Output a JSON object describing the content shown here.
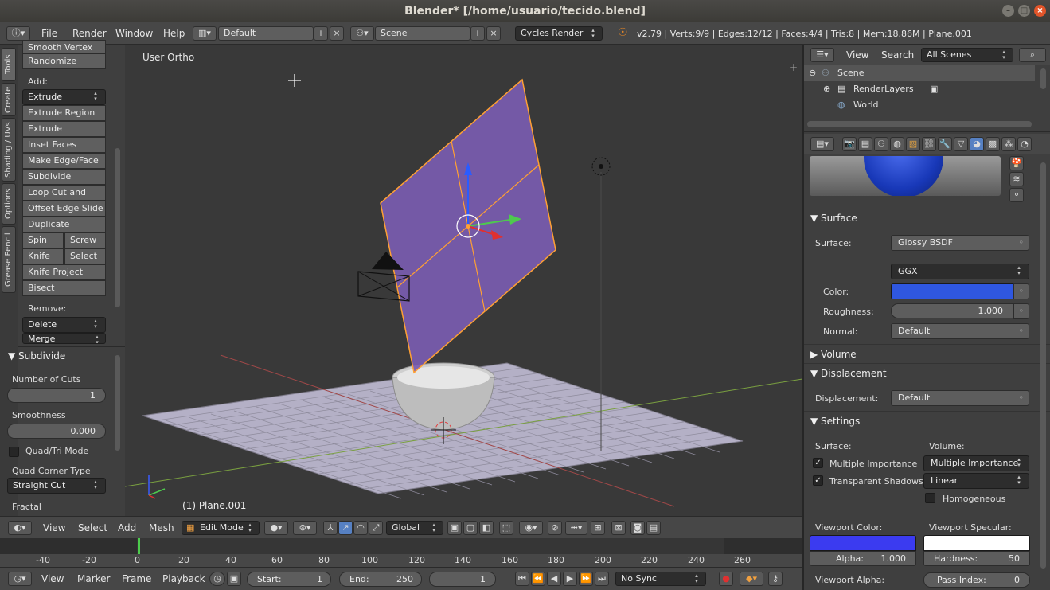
{
  "window": {
    "title": "Blender* [/home/usuario/tecido.blend]"
  },
  "infobar": {
    "menus": [
      "File",
      "Render",
      "Window",
      "Help"
    ],
    "layout": "Default",
    "scene": "Scene",
    "engine": "Cycles Render",
    "stats": "v2.79 | Verts:9/9 | Edges:12/12 | Faces:4/4 | Tris:8 | Mem:18.86M | Plane.001"
  },
  "tool_tabs": [
    "Tools",
    "Create",
    "Shading / UVs",
    "Options",
    "Grease Pencil"
  ],
  "toolshelf": {
    "top_buttons": [
      "Smooth Vertex",
      "Randomize"
    ],
    "add_label": "Add:",
    "extrude": "Extrude",
    "add_buttons": [
      "Extrude Region",
      "Extrude Individual",
      "Inset Faces",
      "Make Edge/Face",
      "Subdivide",
      "Loop Cut and Slide",
      "Offset Edge Slide",
      "Duplicate"
    ],
    "spin": "Spin",
    "screw": "Screw",
    "knife": "Knife",
    "select": "Select",
    "knife_project": "Knife Project",
    "bisect": "Bisect",
    "remove_label": "Remove:",
    "delete": "Delete",
    "merge": "Merge"
  },
  "operator": {
    "title": "Subdivide",
    "cuts_label": "Number of Cuts",
    "cuts": "1",
    "smooth_label": "Smoothness",
    "smoothness": "0.000",
    "quadtri": "Quad/Tri Mode",
    "corner_label": "Quad Corner Type",
    "corner": "Straight Cut",
    "fractal_label": "Fractal"
  },
  "viewport": {
    "view_name": "User Ortho",
    "object_label": "(1) Plane.001"
  },
  "vp_header": {
    "menus": [
      "View",
      "Select",
      "Add",
      "Mesh"
    ],
    "mode": "Edit Mode",
    "orientation": "Global"
  },
  "timeline": {
    "ticks": [
      "-40",
      "-20",
      "0",
      "20",
      "40",
      "60",
      "80",
      "100",
      "120",
      "140",
      "160",
      "180",
      "200",
      "220",
      "240",
      "260"
    ],
    "menus": [
      "View",
      "Marker",
      "Frame",
      "Playback"
    ],
    "start_label": "Start:",
    "start": "1",
    "end_label": "End:",
    "end": "250",
    "current": "1",
    "sync": "No Sync"
  },
  "outliner": {
    "menus": [
      "View",
      "Search"
    ],
    "filter": "All Scenes",
    "items": [
      "Scene",
      "RenderLayers",
      "World"
    ]
  },
  "properties": {
    "surface_section": "Surface",
    "surface_label": "Surface:",
    "surface_value": "Glossy BSDF",
    "distribution": "GGX",
    "color_label": "Color:",
    "roughness_label": "Roughness:",
    "roughness": "1.000",
    "normal_label": "Normal:",
    "normal": "Default",
    "volume_section": "Volume",
    "displacement_section": "Displacement",
    "displacement_label": "Displacement:",
    "displacement": "Default",
    "settings_section": "Settings",
    "surface_col": "Surface:",
    "volume_col": "Volume:",
    "mult_imp": "Multiple Importance",
    "trans_shadows": "Transparent Shadows",
    "vol_sampling": "Multiple Importance",
    "vol_interp": "Linear",
    "homogeneous": "Homogeneous",
    "vp_color_label": "Viewport Color:",
    "alpha_label": "Alpha:",
    "alpha": "1.000",
    "vp_spec_label": "Viewport Specular:",
    "hardness_label": "Hardness:",
    "hardness": "50",
    "vp_alpha_label": "Viewport Alpha:",
    "pass_label": "Pass Index:",
    "pass_index": "0"
  },
  "colors": {
    "material_blue": "#2f57e0",
    "viewport_color": "#3b3bf0",
    "selection_orange": "#ffa033",
    "plane_purple": "#7a5cb0"
  }
}
